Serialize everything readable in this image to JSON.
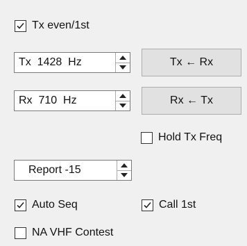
{
  "tx_even": {
    "label": "Tx even/1st",
    "checked": true
  },
  "tx_freq": {
    "label": "Tx",
    "value": "1428",
    "unit": "Hz"
  },
  "tx_from_rx_button": "Tx ← Rx",
  "rx_freq": {
    "label": "Rx",
    "value": "710",
    "unit": "Hz"
  },
  "rx_from_tx_button": "Rx ← Tx",
  "hold_tx_freq": {
    "label": "Hold Tx Freq",
    "checked": false
  },
  "report": {
    "label": "Report",
    "value": "-15"
  },
  "auto_seq": {
    "label": "Auto Seq",
    "checked": true
  },
  "call_1st": {
    "label": "Call 1st",
    "checked": true
  },
  "na_vhf_contest": {
    "label": "NA VHF Contest",
    "checked": false
  }
}
